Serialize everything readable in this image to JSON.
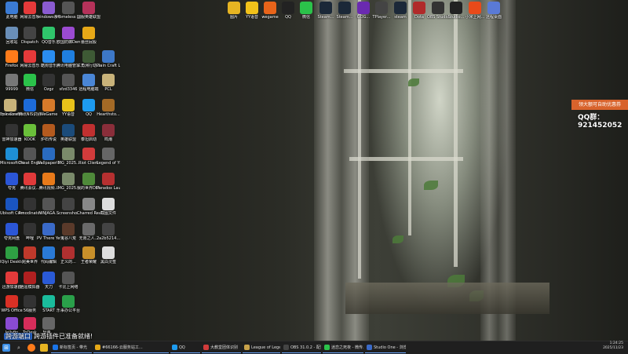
{
  "desktop": {
    "left_icons": [
      {
        "label": "此电脑",
        "color": "#3b7bd4"
      },
      {
        "label": "网易云音乐",
        "color": "#e53a3a"
      },
      {
        "label": "windows系统激活.rar",
        "color": "#8a5bd0"
      },
      {
        "label": "Homeless Life Sim...",
        "color": "#555"
      },
      {
        "label": "国服英雄联盟 (V)",
        "color": "#b5325a"
      },
      {
        "label": "回收站",
        "color": "#6a8fb8"
      },
      {
        "label": "Dispatch",
        "color": "#444"
      },
      {
        "label": "QQ音乐",
        "color": "#2fc56b"
      },
      {
        "label": "欧国防御Demo",
        "color": "#9b4bd1"
      },
      {
        "label": "蕾丝屁股",
        "color": "#e6a817"
      },
      {
        "label": "Firefox",
        "color": "#ff7b1a"
      },
      {
        "label": "网易云音乐",
        "color": "#e53a3a"
      },
      {
        "label": "酷狗音乐",
        "color": "#2a8df0"
      },
      {
        "label": "腾讯电脑管家",
        "color": "#1f7fe0"
      },
      {
        "label": "三角洲行动Launcher",
        "color": "#3e5a35"
      },
      {
        "label": "Plain Craft Launcher 2",
        "color": "#3d78c8"
      },
      {
        "label": "99999",
        "color": "#777"
      },
      {
        "label": "微信",
        "color": "#2bc24a"
      },
      {
        "label": "Ozgz",
        "color": "#333"
      },
      {
        "label": "sfzd3346",
        "color": "#555"
      },
      {
        "label": "远程电脑端",
        "color": "#4a86d6"
      },
      {
        "label": "PCL",
        "color": "#c9b37a"
      },
      {
        "label": "Epic Games Launcher",
        "color": "#222"
      },
      {
        "label": "腾讯NIS识别",
        "color": "#1d6bd9"
      },
      {
        "label": "WeGame",
        "color": "#d67a2a"
      },
      {
        "label": "YY语音",
        "color": "#e8c21a"
      },
      {
        "label": "QQ",
        "color": "#1d9bf0"
      },
      {
        "label": "Hearthsto...",
        "color": "#a46a26"
      },
      {
        "label": ".minecraft",
        "color": "#c9b37a"
      },
      {
        "label": "雷神加速器",
        "color": "#333"
      },
      {
        "label": "KOOK",
        "color": "#6abf3a"
      },
      {
        "label": "炉石传说",
        "color": "#b45a1e"
      },
      {
        "label": "英雄联盟",
        "color": "#1b4b7a"
      },
      {
        "label": "泰坦启动",
        "color": "#c03030"
      },
      {
        "label": "鸣潮",
        "color": "#8a2e3a"
      },
      {
        "label": "Microsoft Edge",
        "color": "#1e8fd6"
      },
      {
        "label": "Cheat Engine.exe",
        "color": "#555"
      },
      {
        "label": "Wallpaper Engine:...",
        "color": "#2a6bc0"
      },
      {
        "label": "IMG_2025...",
        "color": "#7a8a6a"
      },
      {
        "label": "Riot Client",
        "color": "#d13b3b"
      },
      {
        "label": "Legend of YMIR",
        "color": "#666"
      },
      {
        "label": "夸克",
        "color": "#2b56d6"
      },
      {
        "label": "腾讯会议...",
        "color": "#e03a3a"
      },
      {
        "label": "腾讯视频...",
        "color": "#e87a1a"
      },
      {
        "label": "IMG_2025...",
        "color": "#7a8a6a"
      },
      {
        "label": "我的世界DEMO",
        "color": "#4f8a3a"
      },
      {
        "label": "Paradox Launcher v2",
        "color": "#b53030"
      },
      {
        "label": "Ubisoft Connect",
        "color": "#1a55c0"
      },
      {
        "label": "Rmodinator",
        "color": "#333"
      },
      {
        "label": "NINJAGA...",
        "color": "#555"
      },
      {
        "label": "Screensho...",
        "color": "#444"
      },
      {
        "label": "Charred Realm...",
        "color": "#888"
      },
      {
        "label": "截图文件",
        "color": "#ddd"
      },
      {
        "label": "夸克网盘",
        "color": "#2b56d6"
      },
      {
        "label": "哔哩",
        "color": "#333"
      },
      {
        "label": "PV There Yet",
        "color": "#3a6ac8"
      },
      {
        "label": "鬼谷八荒",
        "color": "#5a3a2a"
      },
      {
        "label": "无限之人...",
        "color": "#6a6a6a"
      },
      {
        "label": "2a2b5214...",
        "color": "#444"
      },
      {
        "label": "IQiyi Desktop",
        "color": "#2ea043"
      },
      {
        "label": "完美世界",
        "color": "#c0392b"
      },
      {
        "label": "代码编辑",
        "color": "#2a7ad6"
      },
      {
        "label": "正义的...",
        "color": "#b03030"
      },
      {
        "label": "王者荣耀",
        "color": "#c8902a"
      },
      {
        "label": "黑白灵签",
        "color": "#ddd"
      },
      {
        "label": "迅游加速器",
        "color": "#e23a3a"
      },
      {
        "label": "逍遥模拟器",
        "color": "#b02020"
      },
      {
        "label": "天刀",
        "color": "#2a5ad6"
      },
      {
        "label": "卡比上网络",
        "color": "#555"
      },
      {
        "label": "WPS Office",
        "color": "#d93025"
      },
      {
        "label": "56服务",
        "color": "#333"
      },
      {
        "label": "START",
        "color": "#1abc9c"
      },
      {
        "label": "乐事办公平台...",
        "color": "#2aa04a"
      },
      {
        "label": "Jellyfin",
        "color": "#8a4bd1"
      },
      {
        "label": "ToDesk",
        "color": "#d62d5a"
      },
      {
        "label": "轻量...",
        "color": "#666"
      }
    ],
    "top_icons": [
      {
        "label": "图片",
        "color": "#e6b422"
      },
      {
        "label": "YY语音",
        "color": "#f2c21a"
      },
      {
        "label": "wegame",
        "color": "#e8641a"
      },
      {
        "label": "QQ",
        "color": "#222"
      },
      {
        "label": "微信",
        "color": "#2bc24a"
      },
      {
        "label": "Steam...",
        "color": "#1b2838"
      },
      {
        "label": "Steam...",
        "color": "#1b2838"
      },
      {
        "label": "GOG...",
        "color": "#6a2ab0"
      },
      {
        "label": "TPlayer...",
        "color": "#444"
      },
      {
        "label": "steam",
        "color": "#1b2838"
      },
      {
        "label": "Dota",
        "color": "#b02a2a"
      },
      {
        "label": "OBS Studio",
        "color": "#333"
      },
      {
        "label": "Studio...",
        "color": "#222"
      },
      {
        "label": "小米上网...",
        "color": "#e84a1a"
      },
      {
        "label": "远程桌面",
        "color": "#5a7ad6"
      }
    ]
  },
  "promo": {
    "text": "领大额可自助优惠券",
    "qq": "QQ群：921452052"
  },
  "tip": {
    "badge": "跨游端口",
    "text": "跨游插件已准备就绪!"
  },
  "taskbar": {
    "tasks": [
      {
        "label": "新标签页 - 带光",
        "color": "#1a74e8"
      },
      {
        "label": "#66166-云服务站工...",
        "color": "#e6a817"
      },
      {
        "label": "QQ",
        "color": "#1d9bf0"
      },
      {
        "label": "大教堂团体识别",
        "color": "#d13b3b"
      },
      {
        "label": "League of Legends",
        "color": "#c8a24a"
      },
      {
        "label": "OBS 31.0.2 - 配置...",
        "color": "#444"
      },
      {
        "label": "迷恋之死夜 - 微传...",
        "color": "#2bc24a"
      },
      {
        "label": "Studio One - 浏览...",
        "color": "#3a6ac8"
      }
    ],
    "time": "1:24:25",
    "date": "2025/11/23"
  }
}
